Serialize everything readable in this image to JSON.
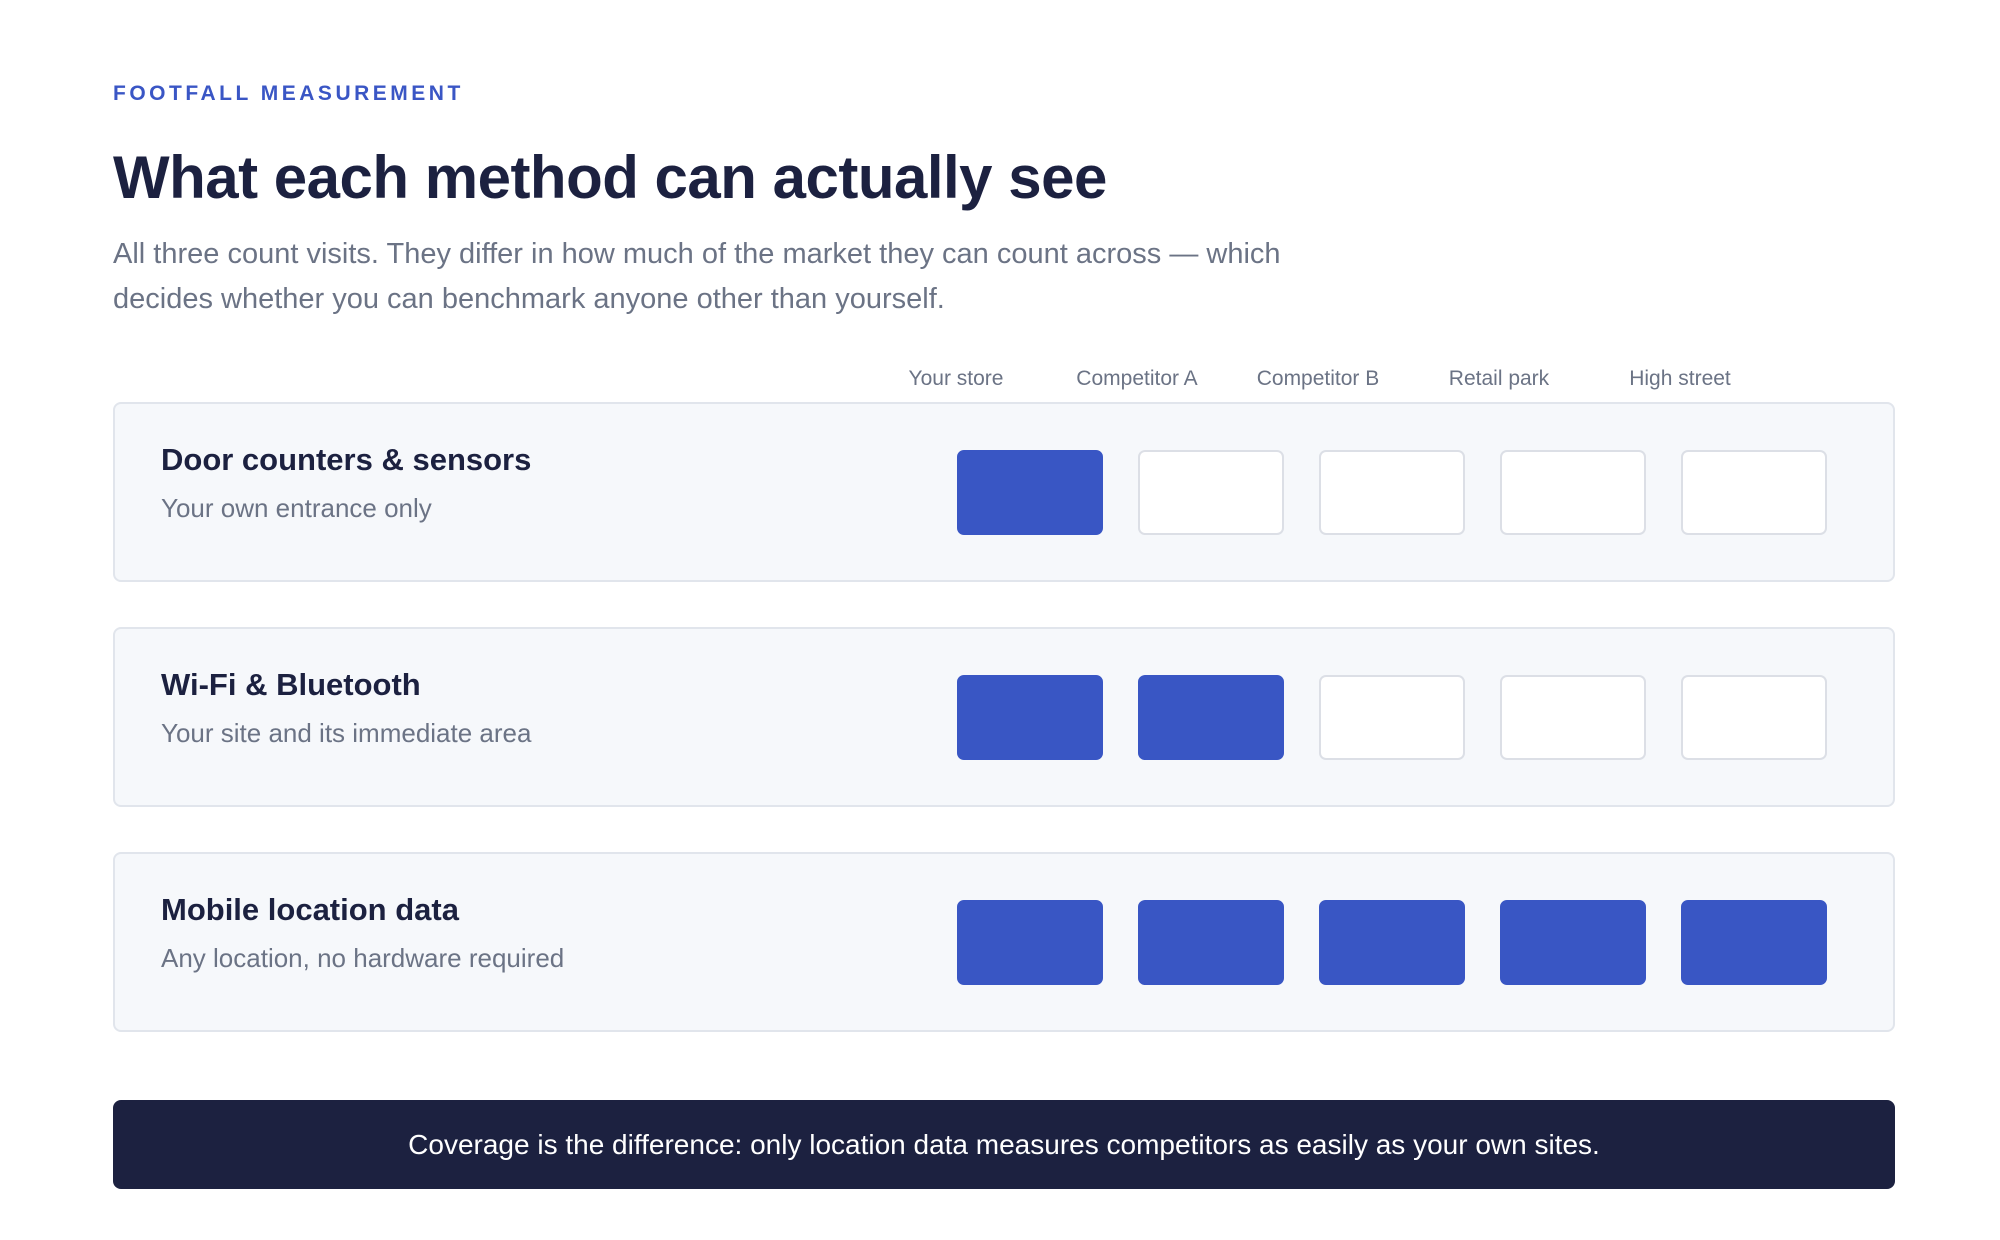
{
  "eyebrow": "FOOTFALL MEASUREMENT",
  "title": "What each method can actually see",
  "subtitle": "All three count visits. They differ in how much of the market they can count across — which decides whether you can benchmark anyone other than yourself.",
  "columns": [
    "Your store",
    "Competitor A",
    "Competitor B",
    "Retail park",
    "High street"
  ],
  "colors": {
    "accent": "#3a56c5",
    "covered": "#3956c4",
    "not_covered": "#ffffff",
    "dark": "#1c2140",
    "muted": "#6b7385"
  },
  "methods": [
    {
      "name": "Door counters & sensors",
      "description": "Your own entrance only",
      "coverage": [
        true,
        false,
        false,
        false,
        false
      ]
    },
    {
      "name": "Wi-Fi & Bluetooth",
      "description": "Your site and its immediate area",
      "coverage": [
        true,
        true,
        false,
        false,
        false
      ]
    },
    {
      "name": "Mobile location data",
      "description": "Any location, no hardware required",
      "coverage": [
        true,
        true,
        true,
        true,
        true
      ]
    }
  ],
  "banner": "Coverage is the difference: only location data measures competitors as easily as your own sites."
}
